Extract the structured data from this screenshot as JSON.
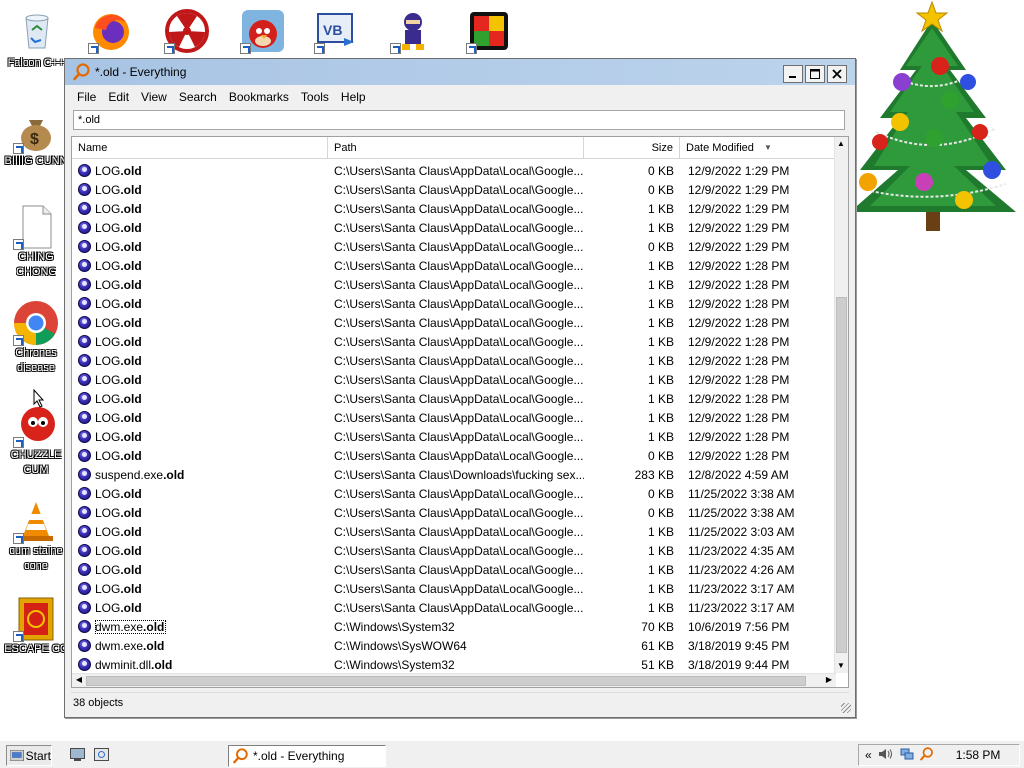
{
  "desktop": {
    "top_icons": [
      {
        "name": "recycle-bin-icon",
        "label": "Falcon C++"
      },
      {
        "name": "firefox-icon"
      },
      {
        "name": "radiation-icon"
      },
      {
        "name": "angry-birds-icon"
      },
      {
        "name": "visual-basic-icon"
      },
      {
        "name": "ninja-icon"
      },
      {
        "name": "colorful-app-icon"
      }
    ],
    "left_icons": [
      {
        "label": "Falcon C++"
      },
      {
        "label": "BIIIIG CUNN"
      },
      {
        "label": "CHING CHONG"
      },
      {
        "label": "Chrones disease"
      },
      {
        "label": "CHUZZLE CUM"
      },
      {
        "label": "cum staine cone"
      },
      {
        "label": "ESCAPE CC"
      }
    ]
  },
  "window": {
    "title": "*.old - Everything",
    "menu": [
      "File",
      "Edit",
      "View",
      "Search",
      "Bookmarks",
      "Tools",
      "Help"
    ],
    "search_value": "*.old",
    "columns": [
      "Name",
      "Path",
      "Size",
      "Date Modified"
    ],
    "status": "38 objects",
    "rows": [
      {
        "base": "LOG",
        "ext": ".old",
        "path": "C:\\Users\\Santa Claus\\AppData\\Local\\Google...",
        "size": "0 KB",
        "date": "12/9/2022 1:29 PM"
      },
      {
        "base": "LOG",
        "ext": ".old",
        "path": "C:\\Users\\Santa Claus\\AppData\\Local\\Google...",
        "size": "0 KB",
        "date": "12/9/2022 1:29 PM"
      },
      {
        "base": "LOG",
        "ext": ".old",
        "path": "C:\\Users\\Santa Claus\\AppData\\Local\\Google...",
        "size": "1 KB",
        "date": "12/9/2022 1:29 PM"
      },
      {
        "base": "LOG",
        "ext": ".old",
        "path": "C:\\Users\\Santa Claus\\AppData\\Local\\Google...",
        "size": "1 KB",
        "date": "12/9/2022 1:29 PM"
      },
      {
        "base": "LOG",
        "ext": ".old",
        "path": "C:\\Users\\Santa Claus\\AppData\\Local\\Google...",
        "size": "0 KB",
        "date": "12/9/2022 1:29 PM"
      },
      {
        "base": "LOG",
        "ext": ".old",
        "path": "C:\\Users\\Santa Claus\\AppData\\Local\\Google...",
        "size": "1 KB",
        "date": "12/9/2022 1:28 PM"
      },
      {
        "base": "LOG",
        "ext": ".old",
        "path": "C:\\Users\\Santa Claus\\AppData\\Local\\Google...",
        "size": "1 KB",
        "date": "12/9/2022 1:28 PM"
      },
      {
        "base": "LOG",
        "ext": ".old",
        "path": "C:\\Users\\Santa Claus\\AppData\\Local\\Google...",
        "size": "1 KB",
        "date": "12/9/2022 1:28 PM"
      },
      {
        "base": "LOG",
        "ext": ".old",
        "path": "C:\\Users\\Santa Claus\\AppData\\Local\\Google...",
        "size": "1 KB",
        "date": "12/9/2022 1:28 PM"
      },
      {
        "base": "LOG",
        "ext": ".old",
        "path": "C:\\Users\\Santa Claus\\AppData\\Local\\Google...",
        "size": "1 KB",
        "date": "12/9/2022 1:28 PM"
      },
      {
        "base": "LOG",
        "ext": ".old",
        "path": "C:\\Users\\Santa Claus\\AppData\\Local\\Google...",
        "size": "1 KB",
        "date": "12/9/2022 1:28 PM"
      },
      {
        "base": "LOG",
        "ext": ".old",
        "path": "C:\\Users\\Santa Claus\\AppData\\Local\\Google...",
        "size": "1 KB",
        "date": "12/9/2022 1:28 PM"
      },
      {
        "base": "LOG",
        "ext": ".old",
        "path": "C:\\Users\\Santa Claus\\AppData\\Local\\Google...",
        "size": "1 KB",
        "date": "12/9/2022 1:28 PM"
      },
      {
        "base": "LOG",
        "ext": ".old",
        "path": "C:\\Users\\Santa Claus\\AppData\\Local\\Google...",
        "size": "1 KB",
        "date": "12/9/2022 1:28 PM"
      },
      {
        "base": "LOG",
        "ext": ".old",
        "path": "C:\\Users\\Santa Claus\\AppData\\Local\\Google...",
        "size": "1 KB",
        "date": "12/9/2022 1:28 PM"
      },
      {
        "base": "LOG",
        "ext": ".old",
        "path": "C:\\Users\\Santa Claus\\AppData\\Local\\Google...",
        "size": "0 KB",
        "date": "12/9/2022 1:28 PM"
      },
      {
        "base": "suspend.exe",
        "ext": ".old",
        "path": "C:\\Users\\Santa Claus\\Downloads\\fucking sex...",
        "size": "283 KB",
        "date": "12/8/2022 4:59 AM"
      },
      {
        "base": "LOG",
        "ext": ".old",
        "path": "C:\\Users\\Santa Claus\\AppData\\Local\\Google...",
        "size": "0 KB",
        "date": "11/25/2022 3:38 AM"
      },
      {
        "base": "LOG",
        "ext": ".old",
        "path": "C:\\Users\\Santa Claus\\AppData\\Local\\Google...",
        "size": "0 KB",
        "date": "11/25/2022 3:38 AM"
      },
      {
        "base": "LOG",
        "ext": ".old",
        "path": "C:\\Users\\Santa Claus\\AppData\\Local\\Google...",
        "size": "1 KB",
        "date": "11/25/2022 3:03 AM"
      },
      {
        "base": "LOG",
        "ext": ".old",
        "path": "C:\\Users\\Santa Claus\\AppData\\Local\\Google...",
        "size": "1 KB",
        "date": "11/23/2022 4:35 AM"
      },
      {
        "base": "LOG",
        "ext": ".old",
        "path": "C:\\Users\\Santa Claus\\AppData\\Local\\Google...",
        "size": "1 KB",
        "date": "11/23/2022 4:26 AM"
      },
      {
        "base": "LOG",
        "ext": ".old",
        "path": "C:\\Users\\Santa Claus\\AppData\\Local\\Google...",
        "size": "1 KB",
        "date": "11/23/2022 3:17 AM"
      },
      {
        "base": "LOG",
        "ext": ".old",
        "path": "C:\\Users\\Santa Claus\\AppData\\Local\\Google...",
        "size": "1 KB",
        "date": "11/23/2022 3:17 AM"
      },
      {
        "base": "dwm.exe",
        "ext": ".old",
        "path": "C:\\Windows\\System32",
        "size": "70 KB",
        "date": "10/6/2019 7:56 PM",
        "focused": true
      },
      {
        "base": "dwm.exe",
        "ext": ".old",
        "path": "C:\\Windows\\SysWOW64",
        "size": "61 KB",
        "date": "3/18/2019 9:45 PM"
      },
      {
        "base": "dwminit.dll",
        "ext": ".old",
        "path": "C:\\Windows\\System32",
        "size": "51 KB",
        "date": "3/18/2019 9:44 PM"
      }
    ]
  },
  "taskbar": {
    "start_label": "Start",
    "task_label": "*.old - Everything",
    "tray_chevron": "«",
    "clock": "1:58 PM"
  },
  "colors": {
    "title_bar": "#a8c4e4",
    "file_icon": "#3b2fb8",
    "taskbar": "#f0f0f0"
  }
}
